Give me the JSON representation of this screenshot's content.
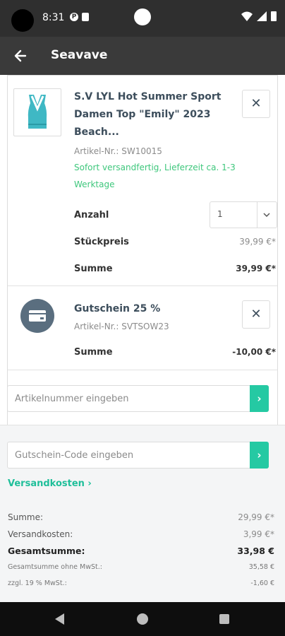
{
  "status_bar": {
    "time": "8:31",
    "icons": [
      "media-icon",
      "sim-icon",
      "wifi-icon",
      "signal-icon",
      "battery-icon"
    ]
  },
  "app_bar": {
    "title": "Seavave",
    "back_icon": "arrow-left-icon"
  },
  "cart": {
    "product": {
      "title": "S.V LYL Hot Summer Sport Damen Top \"Emily\" 2023 Beach...",
      "article_no": "Artikel-Nr.: SW10015",
      "stock": "Sofort versandfertig, Lieferzeit ca. 1-3 Werktage",
      "qty_label": "Anzahl",
      "qty_value": "1",
      "unit_price_label": "Stückpreis",
      "unit_price": "39,99 €*",
      "sum_label": "Summe",
      "sum": "39,99 €*",
      "remove_icon": "close-icon",
      "image_color": "#3fb8c4"
    },
    "voucher": {
      "title": "Gutschein 25 %",
      "article_no": "Artikel-Nr.: SVTSOW23",
      "sum_label": "Summe",
      "sum": "-10,00 €*",
      "icon": "voucher-icon",
      "remove_icon": "close-icon"
    },
    "article_input": {
      "placeholder": "Artikelnummer eingeben",
      "button_icon": "chevron-right-icon"
    }
  },
  "checkout": {
    "voucher_input": {
      "placeholder": "Gutschein-Code eingeben",
      "button_icon": "chevron-right-icon"
    },
    "shipping_link": "Versandkosten ›",
    "summary": [
      {
        "label": "Summe:",
        "value": "29,99 €*",
        "style": "normal"
      },
      {
        "label": "Versandkosten:",
        "value": "3,99 €*",
        "style": "normal"
      },
      {
        "label": "Gesamtsumme:",
        "value": "33,98 €",
        "style": "bold"
      },
      {
        "label": "Gesamtsumme ohne MwSt.:",
        "value": "35,58 €",
        "style": "small"
      },
      {
        "label": "zzgl. 19 % MwSt.:",
        "value": "-1,60 €",
        "style": "small"
      }
    ]
  },
  "colors": {
    "accent": "#25c9a3",
    "stock_green": "#3ec77c",
    "title_dark": "#3d4e5c",
    "app_bar": "#3a3a3a"
  }
}
